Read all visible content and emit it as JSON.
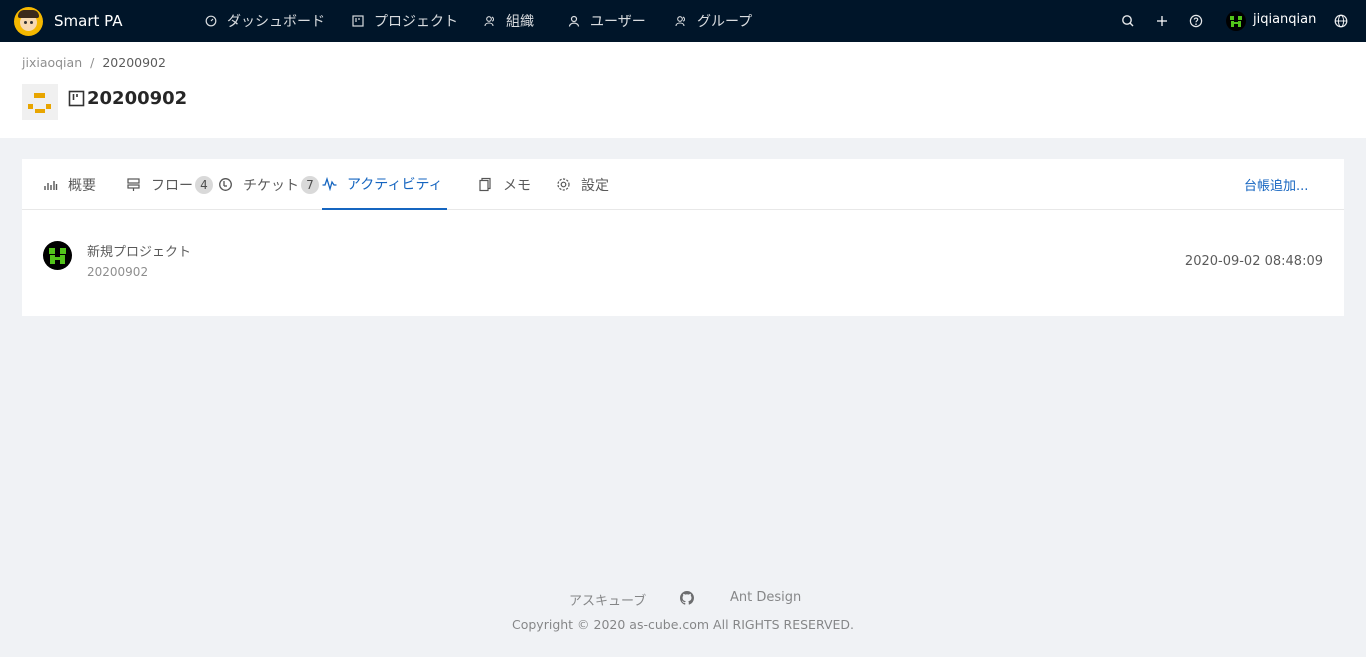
{
  "header": {
    "brand": "Smart PA",
    "nav": [
      {
        "label": "ダッシュボード",
        "icon": "dashboard-icon"
      },
      {
        "label": "プロジェクト",
        "icon": "project-icon"
      },
      {
        "label": "組織",
        "icon": "team-icon"
      },
      {
        "label": "ユーザー",
        "icon": "user-icon"
      },
      {
        "label": "グループ",
        "icon": "group-icon"
      }
    ],
    "username": "jiqianqian"
  },
  "breadcrumb": {
    "parent": "jixiaoqian",
    "separator": "/",
    "current": "20200902"
  },
  "project": {
    "title": "20200902"
  },
  "tabs": [
    {
      "label": "概要",
      "icon": "bar-chart-icon"
    },
    {
      "label": "フロー",
      "icon": "flow-icon",
      "badge": "4"
    },
    {
      "label": "チケット",
      "icon": "ticket-icon",
      "badge": "7"
    },
    {
      "label": "アクティビティ",
      "icon": "activity-icon",
      "active": true
    },
    {
      "label": "メモ",
      "icon": "memo-icon"
    },
    {
      "label": "設定",
      "icon": "setting-icon"
    }
  ],
  "tab_extra": "台帳追加...",
  "activity": {
    "title": "新規プロジェクト",
    "description": "20200902",
    "time": "2020-09-02 08:48:09"
  },
  "footer": {
    "links": [
      "アスキューブ",
      "Ant Design"
    ],
    "github_icon": "github-icon",
    "copyright": "Copyright © 2020 as-cube.com All RIGHTS RESERVED."
  },
  "colors": {
    "header_bg": "#001529",
    "accent": "#1565c0",
    "page_bg": "#f0f2f5"
  }
}
